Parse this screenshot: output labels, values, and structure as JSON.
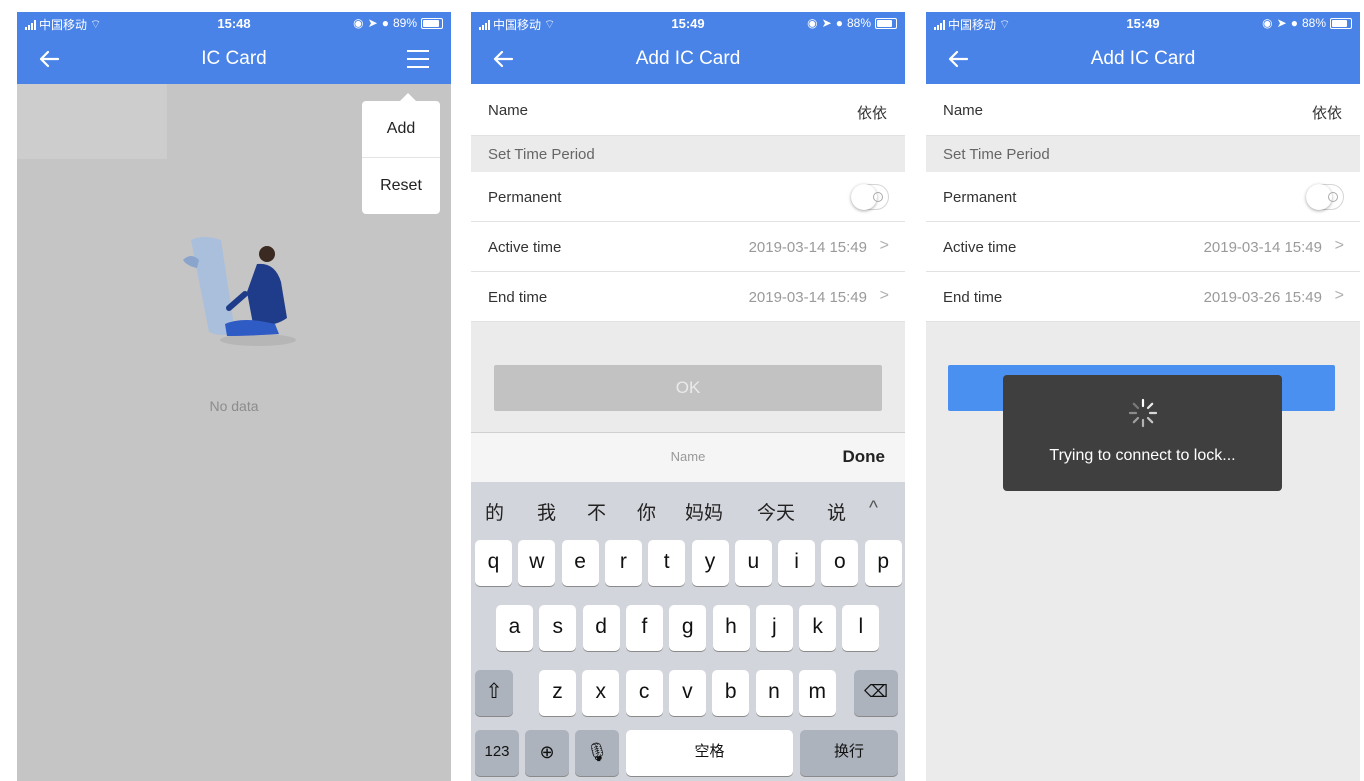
{
  "screens": [
    {
      "status": {
        "carrier": "中国移动",
        "time": "15:48",
        "battery": "89%"
      },
      "nav": {
        "title": "IC Card"
      },
      "menu": {
        "items": [
          "Add",
          "Reset"
        ]
      },
      "empty": {
        "text": "No data"
      }
    },
    {
      "status": {
        "carrier": "中国移动",
        "time": "15:49",
        "battery": "88%"
      },
      "nav": {
        "title": "Add IC Card"
      },
      "form": {
        "name_label": "Name",
        "name_value": "依依",
        "section": "Set Time Period",
        "permanent_label": "Permanent",
        "active_label": "Active time",
        "active_value": "2019-03-14 15:49",
        "end_label": "End time",
        "end_value": "2019-03-14 15:49",
        "ok_label": "OK"
      },
      "keyboard": {
        "field_name": "Name",
        "done": "Done",
        "candidates": [
          "的",
          "我",
          "不",
          "你",
          "妈妈",
          "今天",
          "说",
          "^"
        ],
        "row1": [
          "q",
          "w",
          "e",
          "r",
          "t",
          "y",
          "u",
          "i",
          "o",
          "p"
        ],
        "row2": [
          "a",
          "s",
          "d",
          "f",
          "g",
          "h",
          "j",
          "k",
          "l"
        ],
        "row3": [
          "z",
          "x",
          "c",
          "v",
          "b",
          "n",
          "m"
        ],
        "num_key": "123",
        "space": "空格",
        "return": "换行"
      }
    },
    {
      "status": {
        "carrier": "中国移动",
        "time": "15:49",
        "battery": "88%"
      },
      "nav": {
        "title": "Add IC Card"
      },
      "form": {
        "name_label": "Name",
        "name_value": "依依",
        "section": "Set Time Period",
        "permanent_label": "Permanent",
        "active_label": "Active time",
        "active_value": "2019-03-14 15:49",
        "end_label": "End time",
        "end_value": "2019-03-26 15:49"
      },
      "toast": {
        "message": "Trying to connect to lock..."
      }
    }
  ],
  "colors": {
    "nav_blue": "#4a83e8",
    "ok_blue": "#4a90f0",
    "overlay_gray": "#c5c5c5"
  }
}
